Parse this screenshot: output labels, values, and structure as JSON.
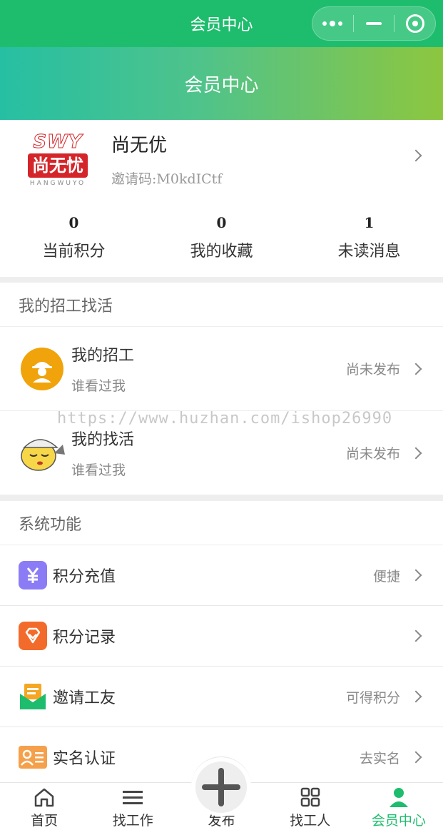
{
  "topbar": {
    "title": "会员中心"
  },
  "header": {
    "title": "会员中心"
  },
  "profile": {
    "logo_top": "SWY",
    "logo_main": "尚无忧",
    "logo_sub": "HANGWUYO",
    "name": "尚无优",
    "invite_code": "邀请码:M0kdICtf"
  },
  "stats": [
    {
      "value": "0",
      "label": "当前积分"
    },
    {
      "value": "0",
      "label": "我的收藏"
    },
    {
      "value": "1",
      "label": "未读消息"
    }
  ],
  "section_jobs": {
    "title": "我的招工找活",
    "items": [
      {
        "title": "我的招工",
        "sub": "谁看过我",
        "status": "尚未发布",
        "icon": "worker-icon"
      },
      {
        "title": "我的找活",
        "sub": "谁看过我",
        "status": "尚未发布",
        "icon": "sleepy-face-icon"
      }
    ]
  },
  "watermark": "https://www.huzhan.com/ishop26990",
  "section_system": {
    "title": "系统功能",
    "items": [
      {
        "label": "积分充值",
        "value": "便捷",
        "icon": "yuan-icon",
        "color": "#8b7cf6"
      },
      {
        "label": "积分记录",
        "value": "",
        "icon": "gem-icon",
        "color": "#f26b2a"
      },
      {
        "label": "邀请工友",
        "value": "可得积分",
        "icon": "envelope-icon",
        "color": "#f5a623"
      },
      {
        "label": "实名认证",
        "value": "去实名",
        "icon": "id-card-icon",
        "color": "#f5a04a"
      }
    ]
  },
  "tabbar": {
    "items": [
      {
        "label": "首页",
        "icon": "home-icon"
      },
      {
        "label": "找工作",
        "icon": "list-icon"
      },
      {
        "label": "发布",
        "icon": "plus-icon"
      },
      {
        "label": "找工人",
        "icon": "grid-icon"
      },
      {
        "label": "会员中心",
        "icon": "user-icon"
      }
    ],
    "active_color": "#1ebd6d"
  }
}
